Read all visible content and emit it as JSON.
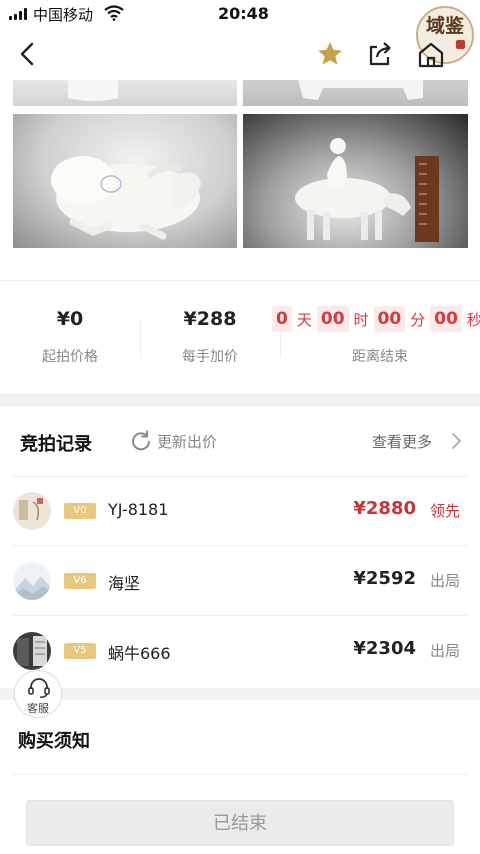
{
  "status_bar": {
    "carrier": "中国移动",
    "time": "20:48"
  },
  "header": {
    "back_icon": "chevron-left-icon",
    "favorite_icon": "star-icon",
    "favorite_color": "#c9a04a",
    "share_icon": "share-icon",
    "home_icon": "home-icon",
    "seal_text": "域鉴"
  },
  "pricing": {
    "starting_price": "¥0",
    "starting_price_label": "起拍价格",
    "increment": "¥288",
    "increment_label": "每手加价",
    "countdown": {
      "days": "0",
      "days_unit": "天",
      "hours": "00",
      "hours_unit": "时",
      "minutes": "00",
      "minutes_unit": "分",
      "seconds": "00",
      "seconds_unit": "秒"
    },
    "countdown_label": "距离结束"
  },
  "bid_records": {
    "title": "竞拍记录",
    "refresh_label": "更新出价",
    "see_more_label": "查看更多",
    "rows": [
      {
        "level": "V0",
        "name": "YJ-8181",
        "amount": "¥2880",
        "status": "领先",
        "leading": true
      },
      {
        "level": "V6",
        "name": "海坚",
        "amount": "¥2592",
        "status": "出局",
        "leading": false
      },
      {
        "level": "V5",
        "name": "蜗牛666",
        "amount": "¥2304",
        "status": "出局",
        "leading": false
      }
    ]
  },
  "purchase_notes": {
    "title": "购买须知"
  },
  "customer_service": {
    "label": "客服"
  },
  "footer": {
    "ended_label": "已结束"
  },
  "colors": {
    "accent_red": "#c83333",
    "badge_gold": "#e9c77b"
  }
}
